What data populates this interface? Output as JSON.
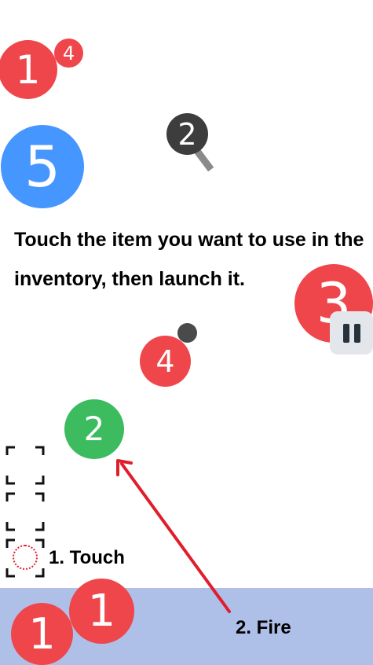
{
  "colors": {
    "red": "#ef464b",
    "blue": "#4696ff",
    "green": "#3cbc5e",
    "dark_gray": "#3d3d3d",
    "small_gray": "#4a4a4a",
    "floor": "#aec0e8",
    "arrow": "#e01e2b",
    "pause_bg": "#e3e7ec",
    "pause_icon": "#28323c",
    "slot_border": "#111111",
    "touch_dots": "#e0202a"
  },
  "balls": {
    "top_red_large": "1",
    "top_red_small": "4",
    "blue": "5",
    "dark_key": "2",
    "right_red": "3",
    "mid_red": "4",
    "green": "2",
    "floor_red_a": "1",
    "floor_red_b": "1"
  },
  "instruction": "Touch the item you want to use in the inventory, then launch it.",
  "labels": {
    "touch": "1. Touch",
    "fire": "2. Fire"
  },
  "icons": {
    "pause": "pause-icon",
    "magnifier_key": "magnifier-icon",
    "inventory_slot": "inventory-slot-bracket-icon"
  }
}
